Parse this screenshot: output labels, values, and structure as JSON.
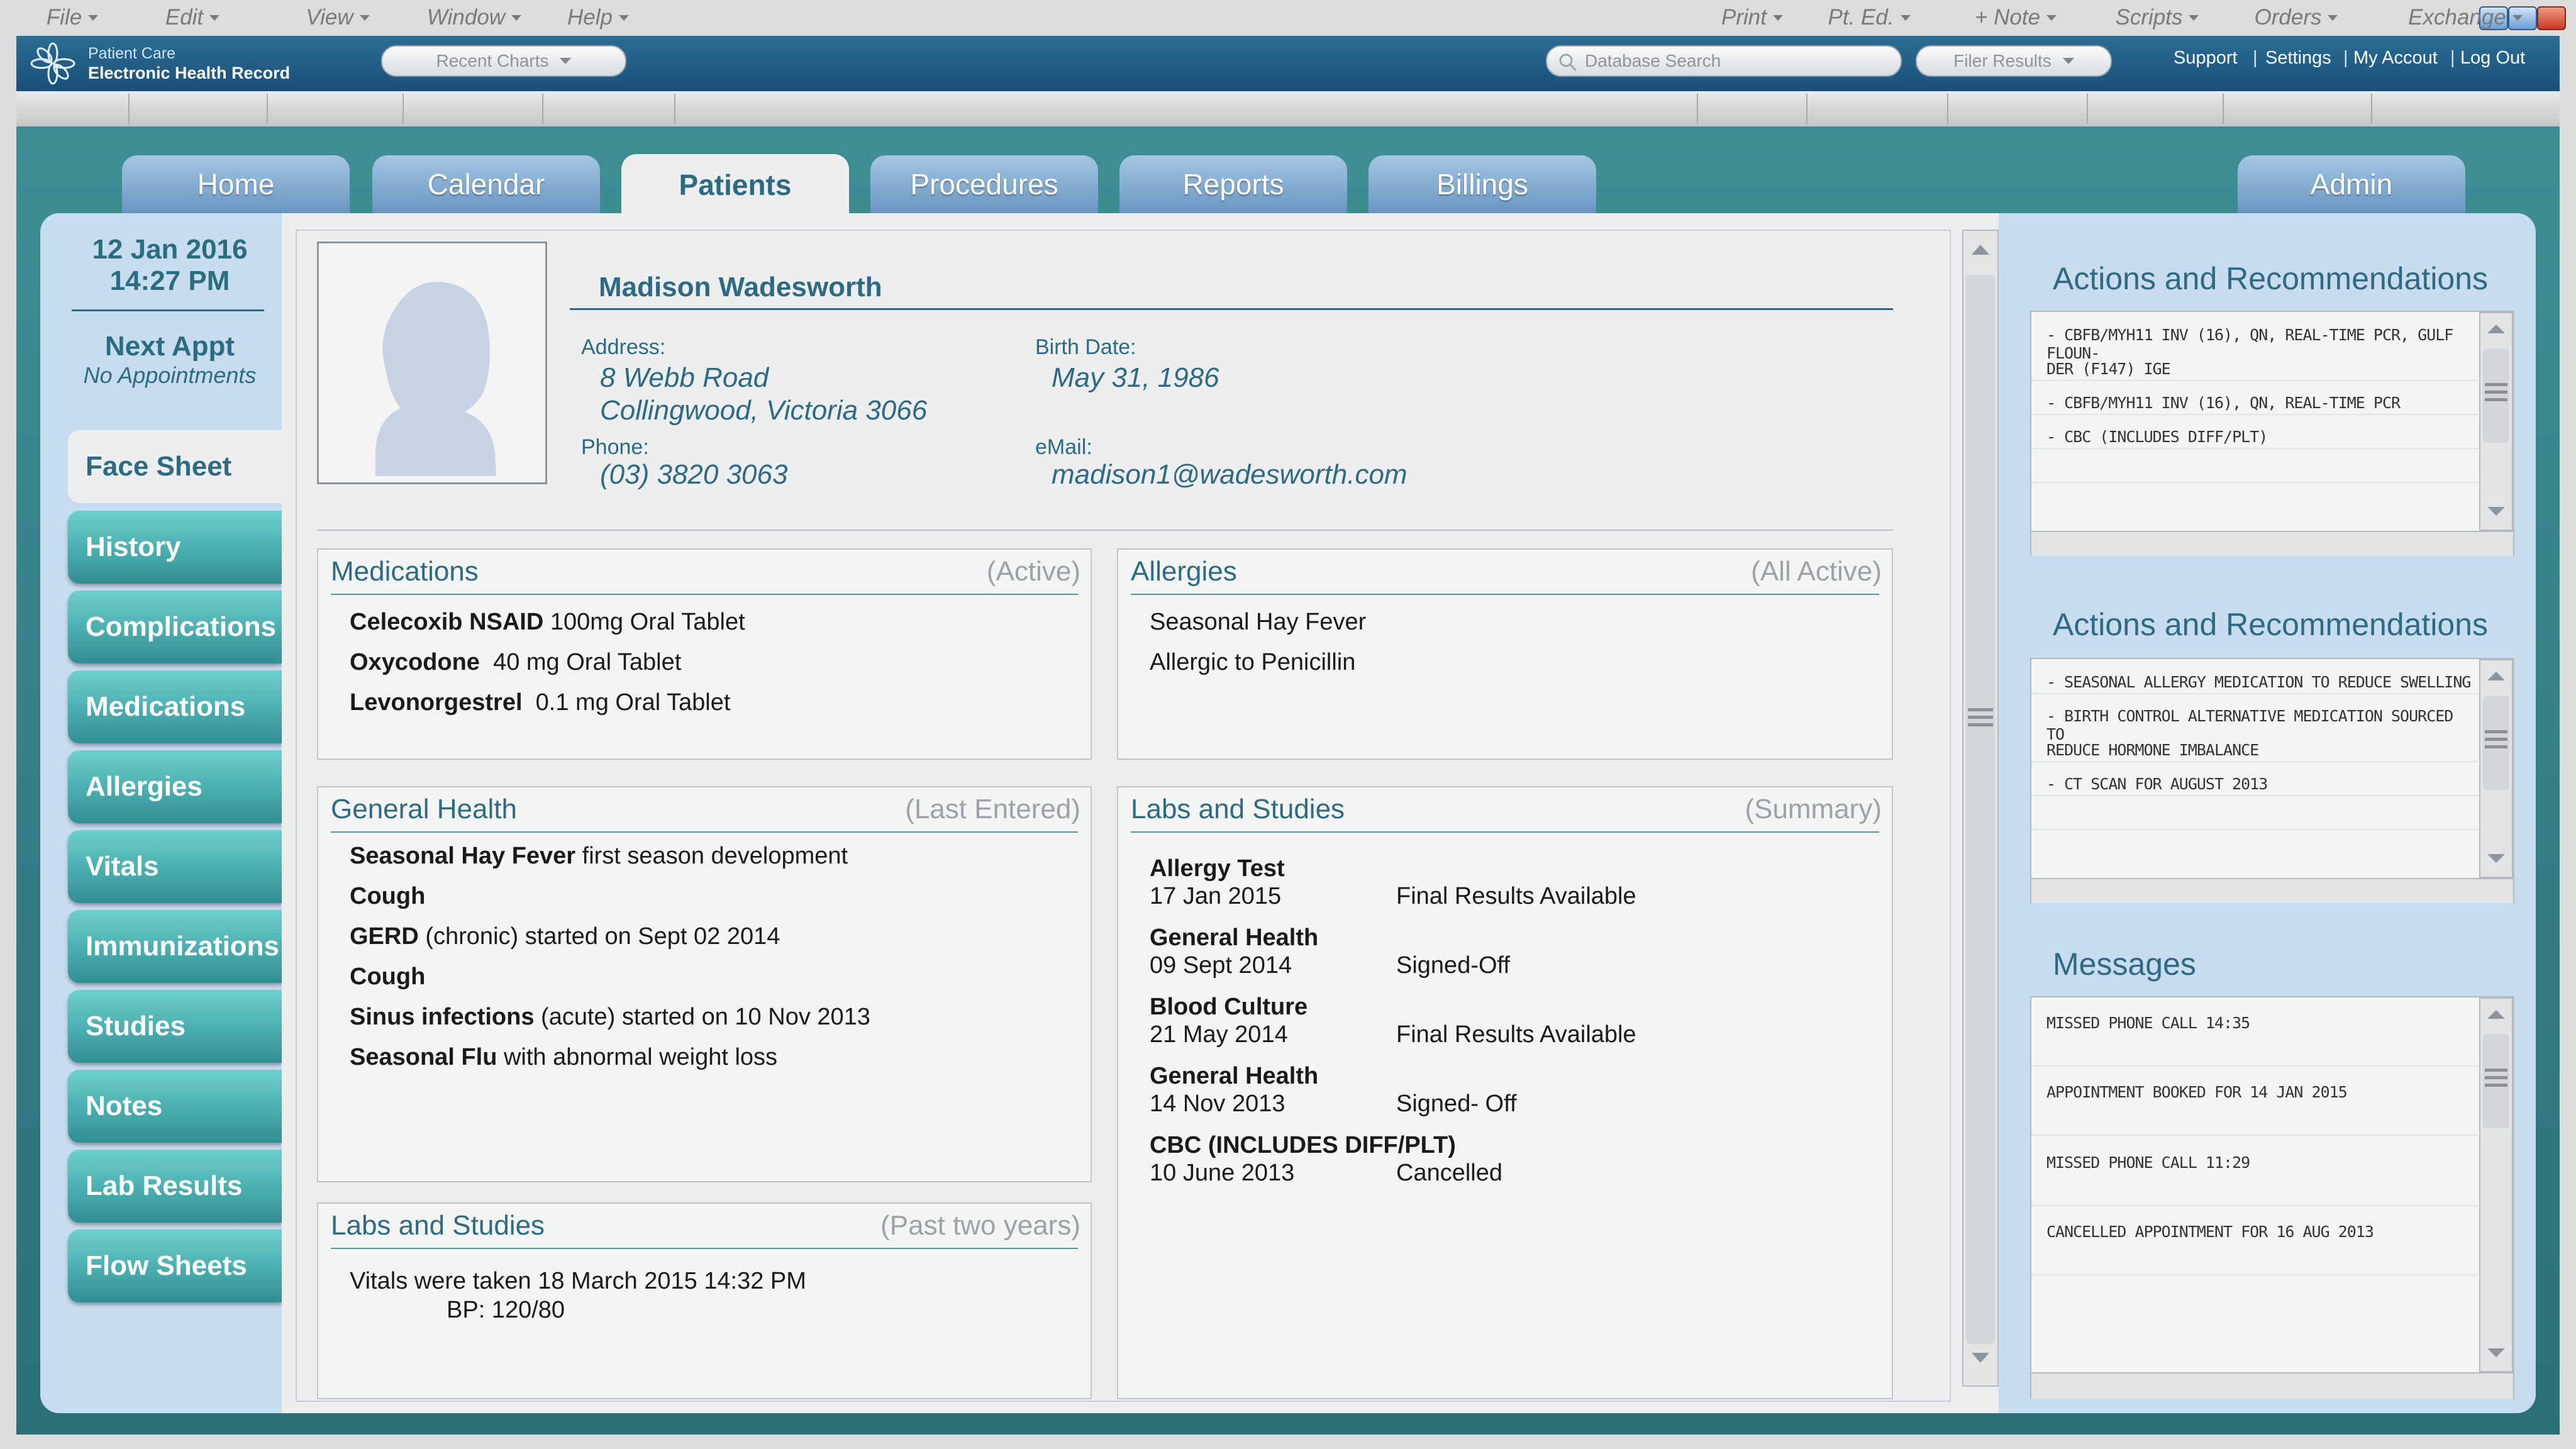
{
  "app": {
    "name_line1": "Patient Care",
    "name_line2": "Electronic Health Record"
  },
  "header": {
    "recent_charts": "Recent Charts",
    "search_placeholder": "Database Search",
    "filter_results": "Filer Results",
    "links": [
      "Support",
      "Settings",
      "My Accout",
      "Log Out"
    ]
  },
  "menubar": {
    "left": [
      "File",
      "Edit",
      "View",
      "Window",
      "Help"
    ],
    "right": [
      "Print",
      "Pt. Ed.",
      "+ Note",
      "Scripts",
      "Orders",
      "Exchange"
    ]
  },
  "tabs": [
    "Home",
    "Calendar",
    "Patients",
    "Procedures",
    "Reports",
    "Billings",
    "Admin"
  ],
  "sidebar": {
    "date": "12 Jan 2016",
    "time": "14:27 PM",
    "next_appt_label": "Next Appt",
    "next_appt_value": "No Appointments",
    "nav": [
      "Face Sheet",
      "History",
      "Complications",
      "Medications",
      "Allergies",
      "Vitals",
      "Immunizations",
      "Studies",
      "Notes",
      "Lab Results",
      "Flow Sheets"
    ]
  },
  "patient": {
    "name": "Madison Wadesworth",
    "address_label": "Address:",
    "address_line1": "8 Webb Road",
    "address_line2": "Collingwood, Victoria 3066",
    "phone_label": "Phone:",
    "phone": "(03) 3820 3063",
    "birth_label": "Birth Date:",
    "birth": "May 31, 1986",
    "email_label": "eMail:",
    "email": "madison1@wadesworth.com"
  },
  "medications": {
    "title": "Medications",
    "status": "(Active)",
    "items": [
      {
        "name": "Celecoxib NSAID",
        "detail": "100mg Oral Tablet"
      },
      {
        "name": "Oxycodone",
        "detail": "40 mg Oral Tablet"
      },
      {
        "name": "Levonorgestrel",
        "detail": "0.1 mg Oral Tablet"
      }
    ]
  },
  "allergies": {
    "title": "Allergies",
    "status": "(All Active)",
    "items": [
      "Seasonal Hay Fever",
      "Allergic to Penicillin"
    ]
  },
  "general_health": {
    "title": "General Health",
    "status": "(Last Entered)",
    "items": [
      {
        "name": "Seasonal Hay Fever",
        "detail": "first season development"
      },
      {
        "name": "Cough",
        "detail": ""
      },
      {
        "name": "GERD",
        "detail": "(chronic) started on Sept 02 2014"
      },
      {
        "name": "Cough",
        "detail": ""
      },
      {
        "name": "Sinus infections",
        "detail": "(acute) started on 10 Nov 2013"
      },
      {
        "name": "Seasonal Flu",
        "detail": "with abnormal weight loss"
      }
    ]
  },
  "labs_summary": {
    "title": "Labs and Studies",
    "status": "(Summary)",
    "items": [
      {
        "name": "Allergy Test",
        "date": "17 Jan 2015",
        "result": "Final Results Available"
      },
      {
        "name": "General Health",
        "date": "09 Sept 2014",
        "result": "Signed-Off"
      },
      {
        "name": "Blood Culture",
        "date": "21 May 2014",
        "result": "Final Results Available"
      },
      {
        "name": "General Health",
        "date": "14 Nov 2013",
        "result": "Signed- Off"
      },
      {
        "name": "CBC (INCLUDES DIFF/PLT)",
        "date": "10 June 2013",
        "result": "Cancelled"
      }
    ]
  },
  "labs_past": {
    "title": "Labs and Studies",
    "status": "(Past two years)",
    "line1": "Vitals were taken 18 March 2015 14:32 PM",
    "line2": "BP: 120/80"
  },
  "right": {
    "actions1_title": "Actions and Recommendations",
    "actions1": [
      "- CBFB/MYH11 INV (16), QN, REAL-TIME PCR, GULF FLOUN-",
      "DER (F147) IGE",
      "- CBFB/MYH11 INV (16), QN, REAL-TIME PCR",
      "- CBC (INCLUDES DIFF/PLT)"
    ],
    "actions2_title": "Actions and Recommendations",
    "actions2": [
      "- SEASONAL ALLERGY MEDICATION TO REDUCE SWELLING",
      "- BIRTH CONTROL ALTERNATIVE MEDICATION SOURCED TO",
      "REDUCE HORMONE IMBALANCE",
      "- CT SCAN FOR AUGUST 2013"
    ],
    "messages_title": "Messages",
    "messages": [
      "MISSED PHONE CALL 14:35",
      "APPOINTMENT BOOKED FOR 14 JAN 2015",
      "MISSED PHONE CALL 11:29",
      "CANCELLED APPOINTMENT FOR 16 AUG 2013"
    ]
  }
}
